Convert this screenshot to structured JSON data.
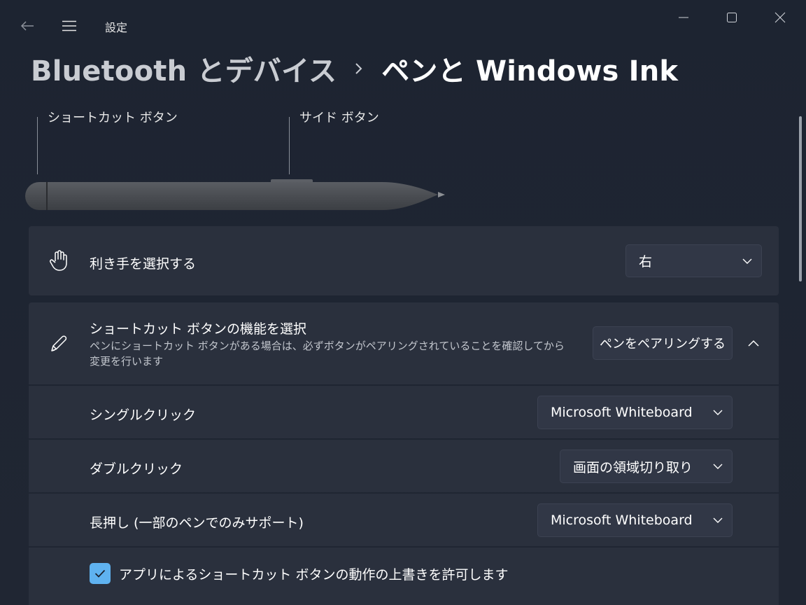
{
  "window": {
    "title": "設定"
  },
  "breadcrumb": {
    "parent": "Bluetooth とデバイス",
    "current": "ペンと Windows Ink"
  },
  "pen_illustration": {
    "shortcut_label": "ショートカット ボタン",
    "side_label": "サイド ボタン"
  },
  "handedness": {
    "title": "利き手を選択する",
    "selected": "右",
    "icon": "hand-icon"
  },
  "shortcut_button": {
    "title": "ショートカット ボタンの機能を選択",
    "description": "ペンにショートカット ボタンがある場合は、必ずボタンがペアリングされていることを確認してから変更を行います",
    "pair_button_label": "ペンをペアリングする",
    "icon": "pen-icon",
    "expanded": true
  },
  "actions": {
    "single_click": {
      "label": "シングルクリック",
      "selected": "Microsoft Whiteboard"
    },
    "double_click": {
      "label": "ダブルクリック",
      "selected": "画面の領域切り取り"
    },
    "long_press": {
      "label": "長押し (一部のペンでのみサポート)",
      "selected": "Microsoft Whiteboard"
    }
  },
  "override": {
    "label": "アプリによるショートカット ボタンの動作の上書きを許可します",
    "checked": true
  },
  "colors": {
    "accent": "#5fb2f0",
    "card_bg": "#2a303d",
    "window_bg": "#1f2430"
  }
}
